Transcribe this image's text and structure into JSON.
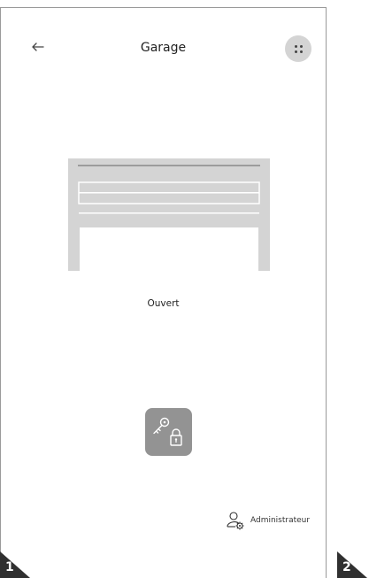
{
  "header": {
    "title": "Garage"
  },
  "door": {
    "status_label": "Ouvert"
  },
  "footer": {
    "role_label": "Administrateur"
  },
  "badges": [
    "1",
    "2"
  ],
  "colors": {
    "accent_gray": "#939393",
    "door_gray": "#d4d4d4"
  },
  "icons": {
    "back": "back-arrow-icon",
    "menu": "dots-grid-icon",
    "lock": "key-lock-icon",
    "user": "user-settings-icon"
  }
}
